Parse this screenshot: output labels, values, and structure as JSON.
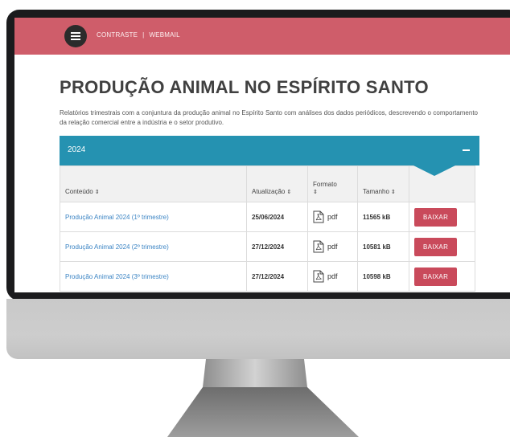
{
  "header": {
    "contrast_label": "CONTRASTE",
    "separator": "|",
    "webmail_label": "WEBMAIL"
  },
  "page": {
    "title": "PRODUÇÃO ANIMAL NO ESPÍRITO SANTO",
    "description": "Relatórios trimestrais com a conjuntura da produção animal no Espírito Santo com análises dos dados periódicos, descrevendo o comportamento da relação comercial entre a indústria e o setor produtivo."
  },
  "accordion": {
    "year": "2024",
    "collapse_symbol": "−"
  },
  "table": {
    "columns": {
      "content": "Conteúdo",
      "updated": "Atualização",
      "format": "Formato",
      "size": "Tamanho"
    },
    "sort_symbol": "⇕",
    "rows": [
      {
        "name": "Produção Animal 2024 (1º trimestre)",
        "updated": "25/06/2024",
        "format": "pdf",
        "size": "11565 kB",
        "action": "BAIXAR"
      },
      {
        "name": "Produção Animal 2024 (2º trimestre)",
        "updated": "27/12/2024",
        "format": "pdf",
        "size": "10581 kB",
        "action": "BAIXAR"
      },
      {
        "name": "Produção Animal 2024 (3º trimestre)",
        "updated": "27/12/2024",
        "format": "pdf",
        "size": "10598 kB",
        "action": "BAIXAR"
      }
    ]
  },
  "colors": {
    "header_bar": "#cf5d6a",
    "accordion": "#2592b1",
    "download_button": "#c94a5b",
    "link": "#3b84c4"
  }
}
